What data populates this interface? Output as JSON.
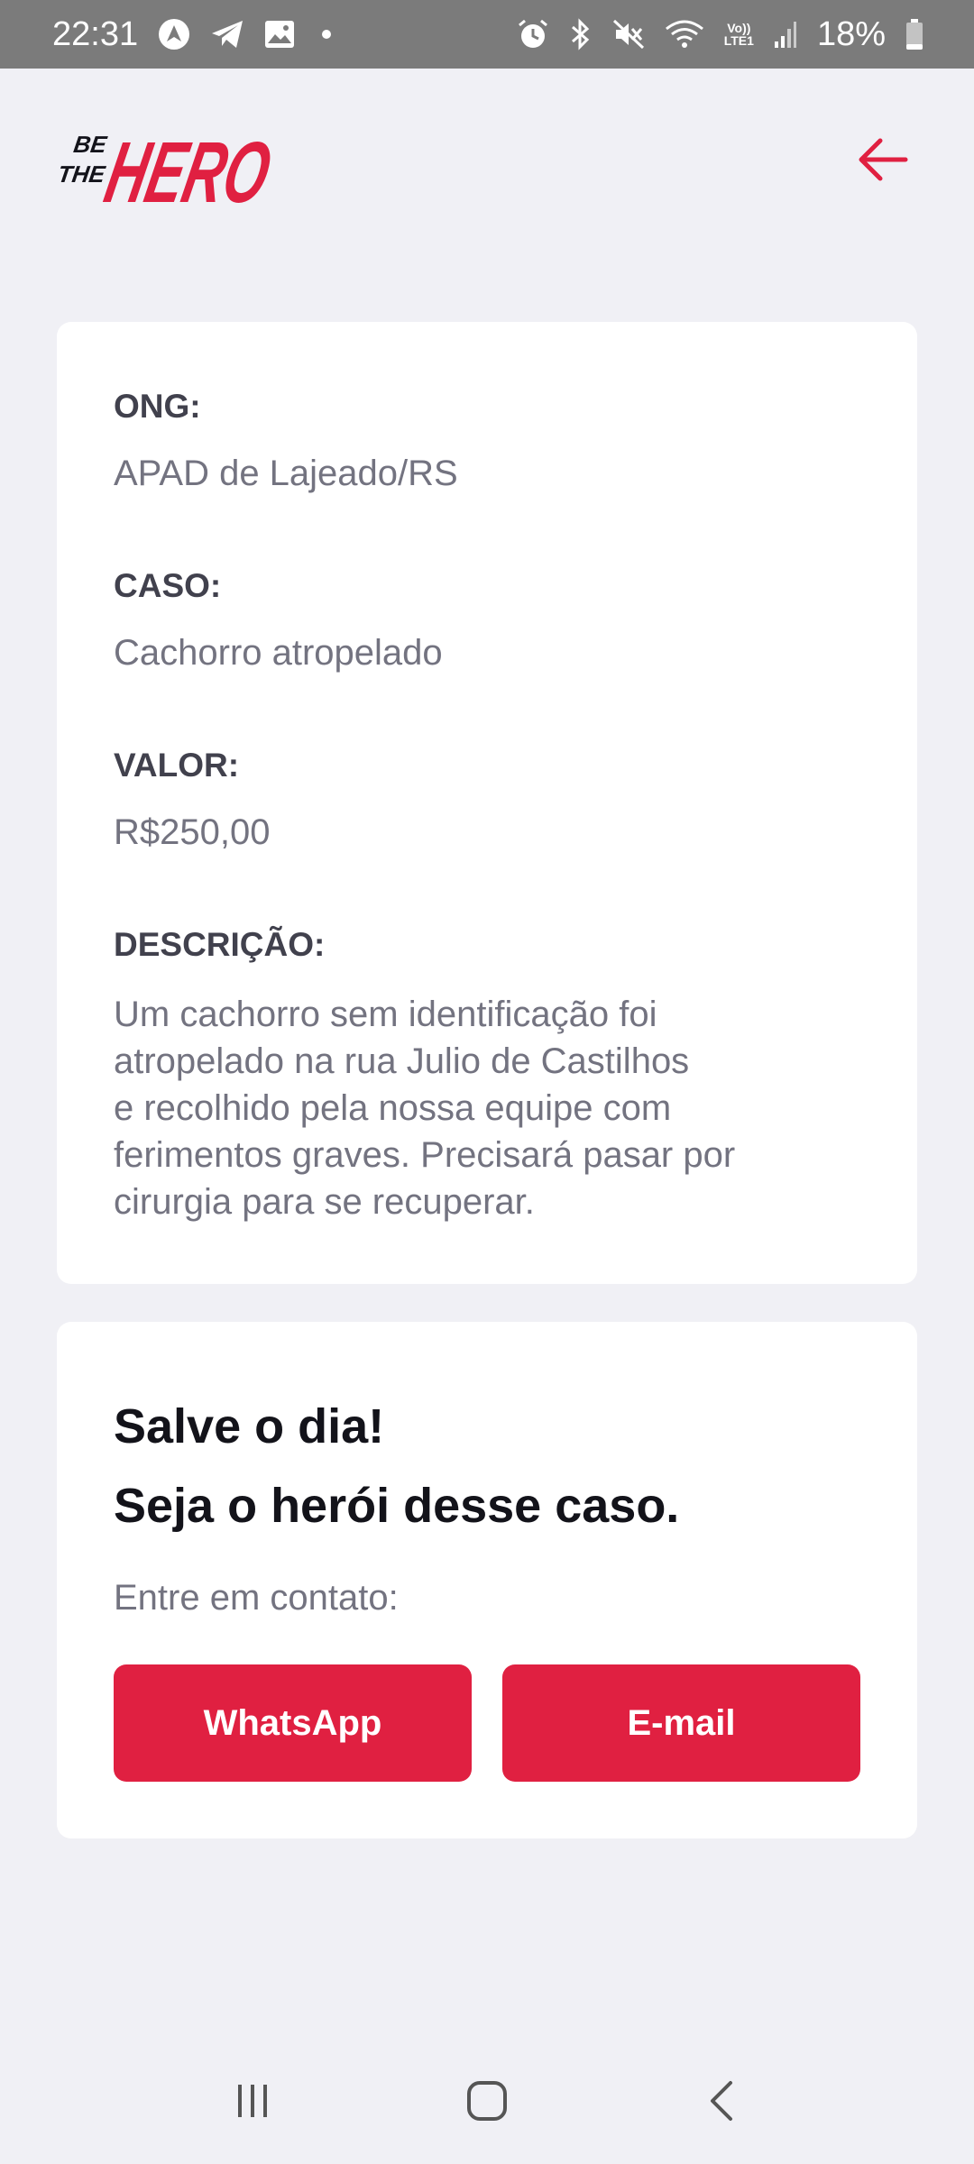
{
  "status_bar": {
    "time": "22:31",
    "battery": "18%",
    "volte": "Vo))",
    "lte": "LTE1",
    "icons": [
      "navigation-icon",
      "telegram-icon",
      "gallery-icon",
      "alarm-icon",
      "bluetooth-icon",
      "mute-icon",
      "wifi-icon",
      "signal-icon",
      "battery-icon"
    ]
  },
  "header": {
    "logo_be": "BE",
    "logo_the": "THE",
    "logo_hero": "HERO",
    "brand_color": "#e02041"
  },
  "incident": {
    "ong_label": "ONG:",
    "ong_value": "APAD de Lajeado/RS",
    "caso_label": "CASO:",
    "caso_value": "Cachorro atropelado",
    "valor_label": "VALOR:",
    "valor_value": "R$250,00",
    "descricao_label": "DESCRIÇÃO:",
    "descricao_lines": [
      "Um cachorro sem identificação foi",
      "atropelado na rua Julio de Castilhos",
      "e recolhido pela nossa equipe com",
      "ferimentos graves. Precisará pasar por",
      "cirurgia para se recuperar."
    ]
  },
  "contact": {
    "title_line1": "Salve o dia!",
    "title_line2": "Seja o herói desse caso.",
    "subtitle": "Entre em contato:",
    "whatsapp_label": "WhatsApp",
    "email_label": "E-mail"
  },
  "nav": {
    "icons": [
      "recent-apps-icon",
      "home-icon",
      "back-icon"
    ]
  }
}
